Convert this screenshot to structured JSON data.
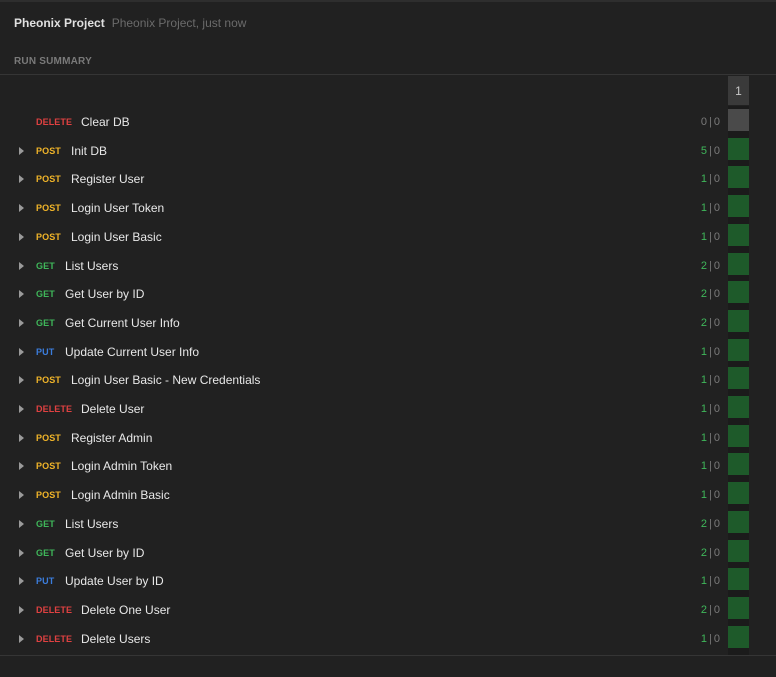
{
  "header": {
    "project_name": "Pheonix Project",
    "meta": "Pheonix Project, just now"
  },
  "section_label": "RUN SUMMARY",
  "iteration_column": "1",
  "colors": {
    "DELETE": "#e04141",
    "POST": "#f0b429",
    "GET": "#3fb75a",
    "PUT": "#3b7ddd",
    "pass_cell": "#1e5a2a",
    "empty_cell": "#4a4a4a"
  },
  "requests": [
    {
      "method": "DELETE",
      "name": "Clear DB",
      "passed": "0",
      "failed": "0",
      "expandable": false
    },
    {
      "method": "POST",
      "name": "Init DB",
      "passed": "5",
      "failed": "0",
      "expandable": true
    },
    {
      "method": "POST",
      "name": "Register User",
      "passed": "1",
      "failed": "0",
      "expandable": true
    },
    {
      "method": "POST",
      "name": "Login User Token",
      "passed": "1",
      "failed": "0",
      "expandable": true
    },
    {
      "method": "POST",
      "name": "Login User Basic",
      "passed": "1",
      "failed": "0",
      "expandable": true
    },
    {
      "method": "GET",
      "name": "List Users",
      "passed": "2",
      "failed": "0",
      "expandable": true
    },
    {
      "method": "GET",
      "name": "Get User by ID",
      "passed": "2",
      "failed": "0",
      "expandable": true
    },
    {
      "method": "GET",
      "name": "Get Current User Info",
      "passed": "2",
      "failed": "0",
      "expandable": true
    },
    {
      "method": "PUT",
      "name": "Update Current User Info",
      "passed": "1",
      "failed": "0",
      "expandable": true
    },
    {
      "method": "POST",
      "name": "Login User Basic - New Credentials",
      "passed": "1",
      "failed": "0",
      "expandable": true
    },
    {
      "method": "DELETE",
      "name": "Delete User",
      "passed": "1",
      "failed": "0",
      "expandable": true
    },
    {
      "method": "POST",
      "name": "Register Admin",
      "passed": "1",
      "failed": "0",
      "expandable": true
    },
    {
      "method": "POST",
      "name": "Login Admin Token",
      "passed": "1",
      "failed": "0",
      "expandable": true
    },
    {
      "method": "POST",
      "name": "Login Admin Basic",
      "passed": "1",
      "failed": "0",
      "expandable": true
    },
    {
      "method": "GET",
      "name": "List Users",
      "passed": "2",
      "failed": "0",
      "expandable": true
    },
    {
      "method": "GET",
      "name": "Get User by ID",
      "passed": "2",
      "failed": "0",
      "expandable": true
    },
    {
      "method": "PUT",
      "name": "Update User by ID",
      "passed": "1",
      "failed": "0",
      "expandable": true
    },
    {
      "method": "DELETE",
      "name": "Delete One User",
      "passed": "2",
      "failed": "0",
      "expandable": true
    },
    {
      "method": "DELETE",
      "name": "Delete Users",
      "passed": "1",
      "failed": "0",
      "expandable": true
    }
  ]
}
